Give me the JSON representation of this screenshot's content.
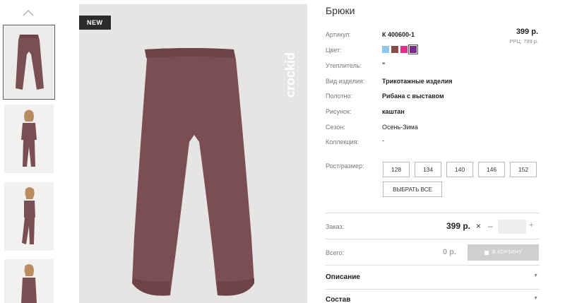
{
  "gallery": {
    "badge": "NEW",
    "brand_mark": "crockid",
    "thumbnails": [
      "pants",
      "child-front",
      "child-side",
      "child-partial"
    ]
  },
  "product": {
    "title": "Брюки",
    "rows": {
      "article": {
        "label": "Артикул:",
        "value": "К 400600-1"
      },
      "color": {
        "label": "Цвет:"
      },
      "insulation": {
        "label": "Утеплитель:",
        "value": "\""
      },
      "type": {
        "label": "Вид изделия:",
        "value": "Трикотажные изделия"
      },
      "fabric": {
        "label": "Полотно:",
        "value": "Рибана с выставом"
      },
      "pattern": {
        "label": "Рисунок:",
        "value": "каштан"
      },
      "season": {
        "label": "Сезон:",
        "value": "Осень-Зима"
      },
      "collection": {
        "label": "Коллекция:",
        "value": "-"
      }
    },
    "price": "399 р.",
    "rrp": "РРЦ: 799 р.",
    "swatch_colors": [
      "#8fc6ee",
      "#8b4a4a",
      "#e0318a",
      "#7b2a8a"
    ]
  },
  "sizes": {
    "label": "Рост/размер:",
    "options": [
      "128",
      "134",
      "140",
      "146",
      "152"
    ],
    "select_all": "ВЫБРАТЬ ВСЕ"
  },
  "order": {
    "label": "Заказ:",
    "price": "399 р.",
    "remove": "×",
    "minus": "–",
    "plus": "+",
    "quantity": ""
  },
  "total": {
    "label": "Всего:",
    "value": "0 р.",
    "cart_button": "В КОРЗИНУ"
  },
  "accordions": {
    "description": "Описание",
    "composition": "Состав"
  }
}
